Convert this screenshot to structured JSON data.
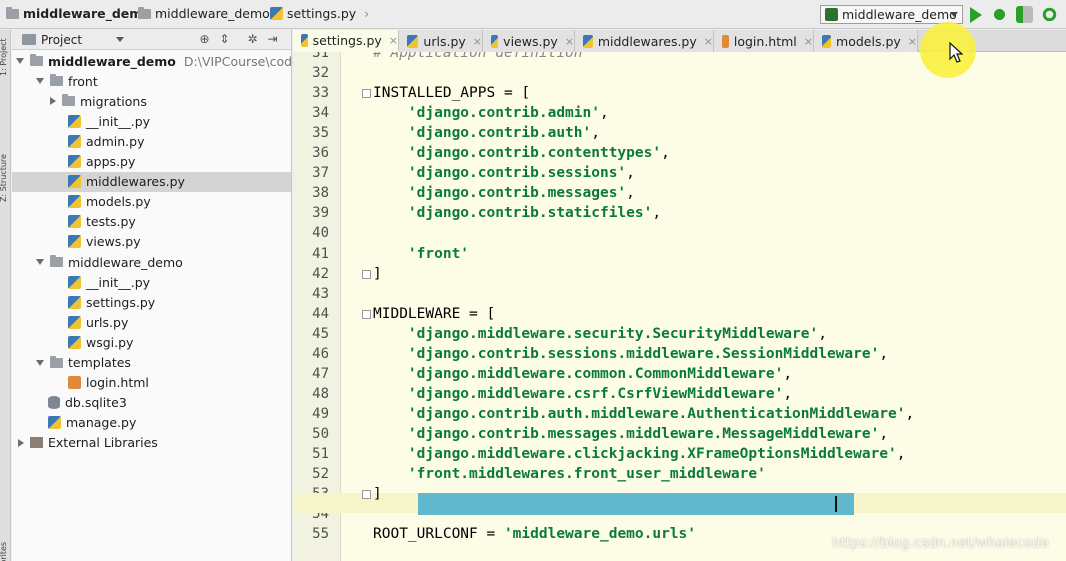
{
  "navbar": {
    "crumbs": [
      "middleware_demo",
      "middleware_demo",
      "settings.py"
    ],
    "run_config": "middleware_demo"
  },
  "stripe": {
    "labels": [
      "1: Project",
      "Z: Structure",
      "Favorites"
    ]
  },
  "project_panel": {
    "title": "Project",
    "tree": [
      {
        "label": "middleware_demo",
        "hint": "D:\\VIPCourse\\codes\\p",
        "icon": "folder-icon",
        "expanded": true
      },
      {
        "label": "front",
        "icon": "folder-icon",
        "expanded": true
      },
      {
        "label": "migrations",
        "icon": "folder-icon",
        "expanded": false
      },
      {
        "label": "__init__.py",
        "icon": "python-file-icon"
      },
      {
        "label": "admin.py",
        "icon": "python-file-icon"
      },
      {
        "label": "apps.py",
        "icon": "python-file-icon"
      },
      {
        "label": "middlewares.py",
        "icon": "python-file-icon",
        "selected": true
      },
      {
        "label": "models.py",
        "icon": "python-file-icon"
      },
      {
        "label": "tests.py",
        "icon": "python-file-icon"
      },
      {
        "label": "views.py",
        "icon": "python-file-icon"
      },
      {
        "label": "middleware_demo",
        "icon": "folder-icon",
        "expanded": true
      },
      {
        "label": "__init__.py",
        "icon": "python-file-icon"
      },
      {
        "label": "settings.py",
        "icon": "python-file-icon"
      },
      {
        "label": "urls.py",
        "icon": "python-file-icon"
      },
      {
        "label": "wsgi.py",
        "icon": "python-file-icon"
      },
      {
        "label": "templates",
        "icon": "folder-icon",
        "expanded": true
      },
      {
        "label": "login.html",
        "icon": "html-file-icon"
      },
      {
        "label": "db.sqlite3",
        "icon": "database-icon"
      },
      {
        "label": "manage.py",
        "icon": "python-file-icon"
      },
      {
        "label": "External Libraries",
        "icon": "library-icon",
        "expanded": false
      }
    ]
  },
  "tabs": [
    {
      "label": "settings.py",
      "active": true
    },
    {
      "label": "urls.py"
    },
    {
      "label": "views.py"
    },
    {
      "label": "middlewares.py"
    },
    {
      "label": "login.html"
    },
    {
      "label": "models.py"
    }
  ],
  "editor": {
    "current_line": "52",
    "lines": [
      {
        "num": "31",
        "text": "# Application definition"
      },
      {
        "num": "32",
        "text": ""
      },
      {
        "num": "33",
        "text": "INSTALLED_APPS = ["
      },
      {
        "num": "34",
        "text": "    'django.contrib.admin',"
      },
      {
        "num": "35",
        "text": "    'django.contrib.auth',"
      },
      {
        "num": "36",
        "text": "    'django.contrib.contenttypes',"
      },
      {
        "num": "37",
        "text": "    'django.contrib.sessions',"
      },
      {
        "num": "38",
        "text": "    'django.contrib.messages',"
      },
      {
        "num": "39",
        "text": "    'django.contrib.staticfiles',"
      },
      {
        "num": "40",
        "text": ""
      },
      {
        "num": "41",
        "text": "    'front'"
      },
      {
        "num": "42",
        "text": "]"
      },
      {
        "num": "43",
        "text": ""
      },
      {
        "num": "44",
        "text": "MIDDLEWARE = ["
      },
      {
        "num": "45",
        "text": "    'django.middleware.security.SecurityMiddleware',"
      },
      {
        "num": "46",
        "text": "    'django.contrib.sessions.middleware.SessionMiddleware',"
      },
      {
        "num": "47",
        "text": "    'django.middleware.common.CommonMiddleware',"
      },
      {
        "num": "48",
        "text": "    'django.middleware.csrf.CsrfViewMiddleware',"
      },
      {
        "num": "49",
        "text": "    'django.contrib.auth.middleware.AuthenticationMiddleware',"
      },
      {
        "num": "50",
        "text": "    'django.contrib.messages.middleware.MessageMiddleware',"
      },
      {
        "num": "51",
        "text": "    'django.middleware.clickjacking.XFrameOptionsMiddleware',"
      },
      {
        "num": "52",
        "text": "    'front.middlewares.front_user_middleware'"
      },
      {
        "num": "53",
        "text": "]"
      },
      {
        "num": "54",
        "text": ""
      },
      {
        "num": "55",
        "text": "ROOT_URLCONF = 'middleware_demo.urls'"
      }
    ]
  },
  "watermark": "https://blog.csdn.net/whalecode",
  "colors": {
    "editor_bg": "#fdfde7",
    "string": "#0a7a3a",
    "selection": "#5fb8cc",
    "run_green": "#2aa02a",
    "cursor_highlight": "#faf03c"
  }
}
